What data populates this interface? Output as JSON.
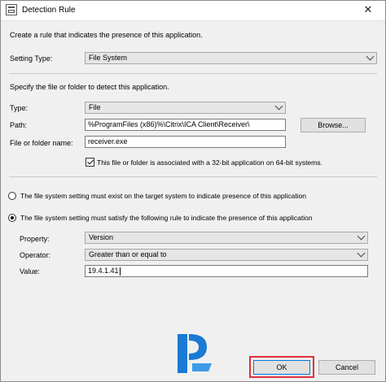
{
  "window": {
    "title": "Detection Rule"
  },
  "intro_text": "Create a rule that indicates the presence of this application.",
  "setting_type": {
    "label": "Setting Type:",
    "value": "File System"
  },
  "specify_text": "Specify the file or folder to detect this application.",
  "type": {
    "label": "Type:",
    "value": "File"
  },
  "path": {
    "label": "Path:",
    "value": "%ProgramFiles (x86)%\\Citrix\\ICA Client\\Receiver\\"
  },
  "browse_button": "Browse...",
  "file_name": {
    "label": "File or folder name:",
    "value": "receiver.exe"
  },
  "bit32_checkbox": {
    "label": "This file or folder is associated with a 32-bit application on 64-bit systems.",
    "checked": true
  },
  "radio_exist": {
    "label": "The file system setting must exist on the target system to indicate presence of this application",
    "selected": false
  },
  "radio_rule": {
    "label": "The file system setting must satisfy the following rule to indicate the presence of this application",
    "selected": true
  },
  "property": {
    "label": "Property:",
    "value": "Version"
  },
  "operator": {
    "label": "Operator:",
    "value": "Greater than or equal to"
  },
  "value_field": {
    "label": "Value:",
    "value": "19.4.1.41"
  },
  "ok_button": "OK",
  "cancel_button": "Cancel",
  "close_glyph": "✕",
  "colors": {
    "highlight": "#e0303a",
    "logo_blue": "#1a7ad4"
  }
}
